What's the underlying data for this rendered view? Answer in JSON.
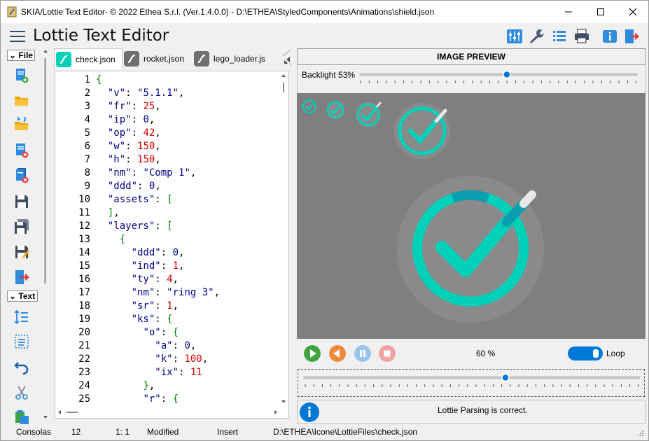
{
  "window": {
    "title": "SKIA/Lottie Text Editor- © 2022 Ethea S.r.l. (Ver.1.4.0.0) - D:\\ETHEA\\StyledComponents\\Animations\\shield.json"
  },
  "header": {
    "app_title": "Lottie Text Editor",
    "toolbar_icons": [
      "settings-sliders-icon",
      "wrench-icon",
      "list-icon",
      "printer-icon",
      "info-icon",
      "exit-icon"
    ]
  },
  "sidebar": {
    "file_group": "File",
    "text_group": "Text",
    "file_icons": [
      "new-file-icon",
      "open-folder-icon",
      "reload-folder-icon",
      "close-file-icon",
      "close-all-icon",
      "save-icon",
      "save-all-icon",
      "save-as-icon",
      "exit-door-icon"
    ],
    "text_icons": [
      "line-spacing-icon",
      "select-all-icon",
      "undo-icon",
      "cut-icon",
      "paste-icon"
    ]
  },
  "tabs": [
    {
      "label": "check.json",
      "active": true
    },
    {
      "label": "rocket.json",
      "active": false
    },
    {
      "label": "lego_loader.js",
      "active": false
    }
  ],
  "editor": {
    "lines": [
      {
        "n": "1",
        "t": "{"
      },
      {
        "n": "2",
        "t": "  \"v\": \"5.1.1\","
      },
      {
        "n": "3",
        "t": "  \"fr\": 25,"
      },
      {
        "n": "4",
        "t": "  \"ip\": 0,"
      },
      {
        "n": "5",
        "t": "  \"op\": 42,"
      },
      {
        "n": "6",
        "t": "  \"w\": 150,"
      },
      {
        "n": "7",
        "t": "  \"h\": 150,"
      },
      {
        "n": "8",
        "t": "  \"nm\": \"Comp 1\","
      },
      {
        "n": "9",
        "t": "  \"ddd\": 0,"
      },
      {
        "n": "10",
        "t": "  \"assets\": ["
      },
      {
        "n": "11",
        "t": "  ],"
      },
      {
        "n": "12",
        "t": "  \"layers\": ["
      },
      {
        "n": "13",
        "t": "    {"
      },
      {
        "n": "14",
        "t": "      \"ddd\": 0,"
      },
      {
        "n": "15",
        "t": "      \"ind\": 1,"
      },
      {
        "n": "16",
        "t": "      \"ty\": 4,"
      },
      {
        "n": "17",
        "t": "      \"nm\": \"ring 3\","
      },
      {
        "n": "18",
        "t": "      \"sr\": 1,"
      },
      {
        "n": "19",
        "t": "      \"ks\": {"
      },
      {
        "n": "20",
        "t": "        \"o\": {"
      },
      {
        "n": "21",
        "t": "          \"a\": 0,"
      },
      {
        "n": "22",
        "t": "          \"k\": 100,"
      },
      {
        "n": "23",
        "t": "          \"ix\": 11"
      },
      {
        "n": "24",
        "t": "        },"
      },
      {
        "n": "25",
        "t": "        \"r\": {"
      }
    ]
  },
  "preview": {
    "title": "IMAGE PREVIEW",
    "backlight_label": "Backlight 53%",
    "backlight_level": 53,
    "zoom_label": "60 %",
    "loop_label": "Loop",
    "loop_on": true,
    "playback_progress": 0.6,
    "status_text": "Lottie Parsing is correct."
  },
  "statusbar": {
    "font": "Consolas",
    "size": "12",
    "position": "1:  1",
    "modified": "Modified",
    "mode": "Insert",
    "path": "D:\\ETHEA\\Icone\\LottieFiles\\check.json"
  },
  "colors": {
    "accent": "#0078d7",
    "teal": "#00d1b8",
    "preview_bg": "#7f7f7f",
    "play_green": "#3fa33f",
    "back_orange": "#f0883a"
  }
}
